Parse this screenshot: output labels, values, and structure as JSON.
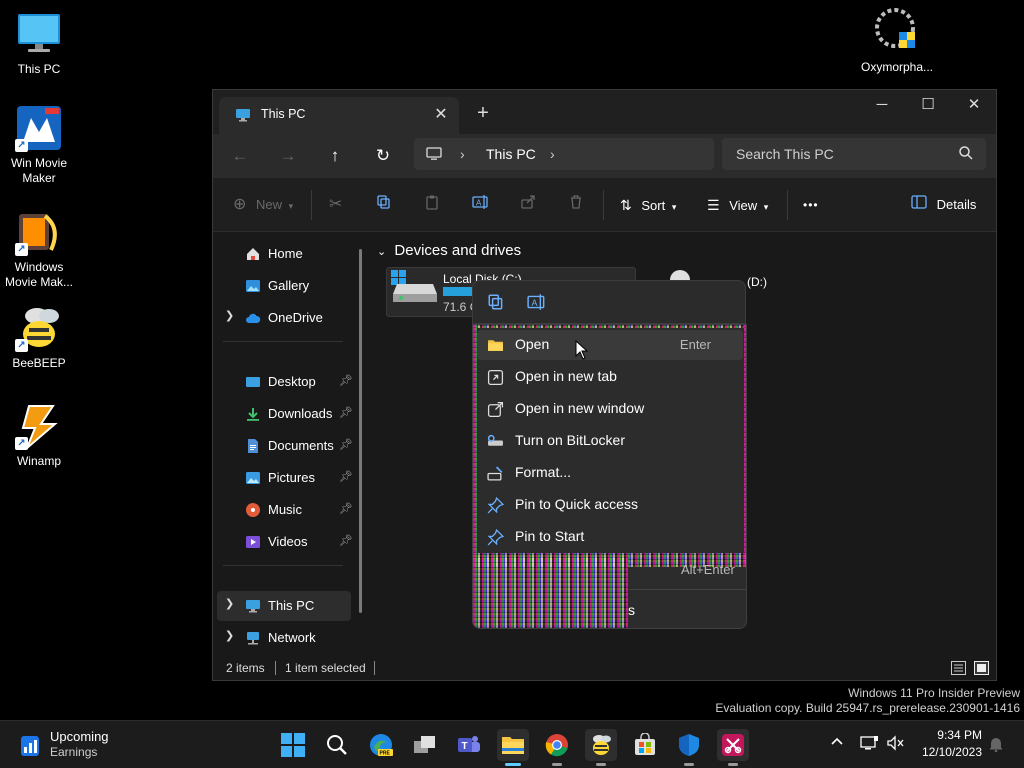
{
  "desktop": {
    "icons": [
      {
        "label": "This PC"
      },
      {
        "label": "Win Movie Maker"
      },
      {
        "label": "Windows Movie Mak..."
      },
      {
        "label": "BeeBEEP"
      },
      {
        "label": "Winamp"
      },
      {
        "label": "Oxymorpha..."
      }
    ]
  },
  "window": {
    "tab_title": "This PC",
    "tab_close": "✕",
    "new_tab": "+",
    "controls": {
      "minimize": "─",
      "maximize": "☐",
      "close": "✕"
    },
    "nav": {
      "back": "←",
      "forward": "→",
      "up": "↑",
      "refresh": "↻"
    },
    "breadcrumb": [
      "This PC"
    ],
    "search_placeholder": "Search This PC",
    "commands": {
      "new": "New",
      "sort": "Sort",
      "view": "View",
      "more": "•••",
      "details": "Details"
    },
    "sidebar": {
      "home": "Home",
      "gallery": "Gallery",
      "onedrive": "OneDrive",
      "desktop": "Desktop",
      "downloads": "Downloads",
      "documents": "Documents",
      "pictures": "Pictures",
      "music": "Music",
      "videos": "Videos",
      "thispc": "This PC",
      "network": "Network"
    },
    "content": {
      "group_header": "Devices and drives",
      "drive_c_name": "Local Disk (C:)",
      "drive_c_size": "71.6 G",
      "drive_d_name": "(D:)"
    },
    "status": {
      "items": "2 items",
      "selected": "1 item selected"
    }
  },
  "context_menu": {
    "items": [
      {
        "label": "Open",
        "shortcut": "Enter"
      },
      {
        "label": "Open in new tab"
      },
      {
        "label": "Open in new window"
      },
      {
        "label": "Turn on BitLocker"
      },
      {
        "label": "Format..."
      },
      {
        "label": "Pin to Quick access"
      },
      {
        "label": "Pin to Start"
      }
    ],
    "partial_shortcut": "Alt+Enter",
    "partial_label": "s"
  },
  "watermark": {
    "line1": "Windows 11 Pro Insider Preview",
    "line2": "Evaluation copy. Build 25947.rs_prerelease.230901-1416"
  },
  "taskbar": {
    "widget_title": "Upcoming",
    "widget_sub": "Earnings",
    "time": "9:34 PM",
    "date": "12/10/2023"
  },
  "colors": {
    "accent": "#60cdff",
    "folder": "#f4c542",
    "window_bg": "#191919"
  }
}
